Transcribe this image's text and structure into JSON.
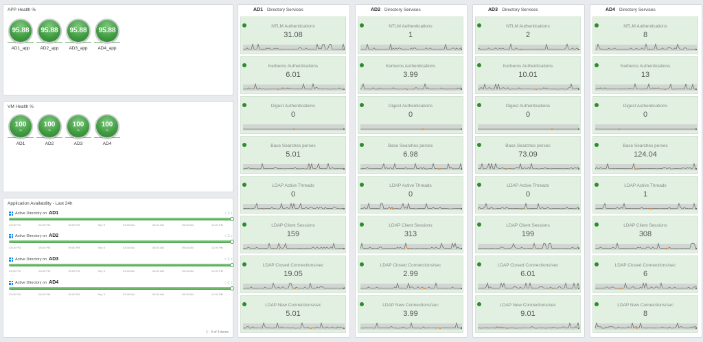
{
  "app_health": {
    "title": "APP Health %",
    "items": [
      {
        "value": "95.88",
        "label": "AD1_app"
      },
      {
        "value": "95.88",
        "label": "AD2_app"
      },
      {
        "value": "95.88",
        "label": "AD3_app"
      },
      {
        "value": "95.88",
        "label": "AD4_app"
      }
    ]
  },
  "vm_health": {
    "title": "VM Health %",
    "unit": "%",
    "items": [
      {
        "value": "100",
        "label": "AD1"
      },
      {
        "value": "100",
        "label": "AD2"
      },
      {
        "value": "100",
        "label": "AD3"
      },
      {
        "value": "100",
        "label": "AD4"
      }
    ]
  },
  "availability": {
    "title": "Application Availability - Last 24h",
    "prefix": "Active Directory on",
    "count": "○ 1 ↕",
    "ticks": [
      "03:00 PM",
      "06:00 PM",
      "09:00 PM",
      "Sep 5",
      "03:00 AM",
      "06:00 AM",
      "09:00 AM",
      "12:00 PM"
    ],
    "items": [
      {
        "server": "AD1"
      },
      {
        "server": "AD2"
      },
      {
        "server": "AD3"
      },
      {
        "server": "AD4"
      }
    ],
    "pager": "1 - 4 of 4 items"
  },
  "columns": [
    {
      "name": "AD1",
      "subtitle": "Directory Services",
      "metrics": [
        {
          "name": "NTLM Authentications",
          "value": "31.08"
        },
        {
          "name": "Kerberos Authentications",
          "value": "6.01"
        },
        {
          "name": "Digest Authentications",
          "value": "0"
        },
        {
          "name": "Base Searches persec",
          "value": "5.01"
        },
        {
          "name": "LDAP Active Threads",
          "value": "0"
        },
        {
          "name": "LDAP Client Sessions",
          "value": "159"
        },
        {
          "name": "LDAP Closed Connections/sec",
          "value": "19.05"
        },
        {
          "name": "LDAP New Connections/sec",
          "value": "5.01"
        }
      ]
    },
    {
      "name": "AD2",
      "subtitle": "Directory Services",
      "metrics": [
        {
          "name": "NTLM Authentications",
          "value": "1"
        },
        {
          "name": "Kerberos Authentications",
          "value": "3.99"
        },
        {
          "name": "Digest Authentications",
          "value": "0"
        },
        {
          "name": "Base Searches persec",
          "value": "6.98"
        },
        {
          "name": "LDAP Active Threads",
          "value": "0"
        },
        {
          "name": "LDAP Client Sessions",
          "value": "313"
        },
        {
          "name": "LDAP Closed Connections/sec",
          "value": "2.99"
        },
        {
          "name": "LDAP New Connections/sec",
          "value": "3.99"
        }
      ]
    },
    {
      "name": "AD3",
      "subtitle": "Directory Services",
      "metrics": [
        {
          "name": "NTLM Authentications",
          "value": "2"
        },
        {
          "name": "Kerberos Authentications",
          "value": "10.01"
        },
        {
          "name": "Digest Authentications",
          "value": "0"
        },
        {
          "name": "Base Searches persec",
          "value": "73.09"
        },
        {
          "name": "LDAP Active Threads",
          "value": "0"
        },
        {
          "name": "LDAP Client Sessions",
          "value": "199"
        },
        {
          "name": "LDAP Closed Connections/sec",
          "value": "6.01"
        },
        {
          "name": "LDAP New Connections/sec",
          "value": "9.01"
        }
      ]
    },
    {
      "name": "AD4",
      "subtitle": "Directory Services",
      "metrics": [
        {
          "name": "NTLM Authentications",
          "value": "8"
        },
        {
          "name": "Kerberos Authentications",
          "value": "13"
        },
        {
          "name": "Digest Authentications",
          "value": "0"
        },
        {
          "name": "Base Searches persec",
          "value": "124.04"
        },
        {
          "name": "LDAP Active Threads",
          "value": "1"
        },
        {
          "name": "LDAP Client Sessions",
          "value": "308"
        },
        {
          "name": "LDAP Closed Connections/sec",
          "value": "6"
        },
        {
          "name": "LDAP New Connections/sec",
          "value": "8"
        }
      ]
    }
  ],
  "colors": {
    "health_green": "#3f9b3f",
    "metric_bg": "#e1f0e1",
    "status_dot": "#2e8b2e",
    "spark_line": "#555555",
    "spark_marker": "#f08c2e",
    "windows_blue": "#1e88e5"
  }
}
